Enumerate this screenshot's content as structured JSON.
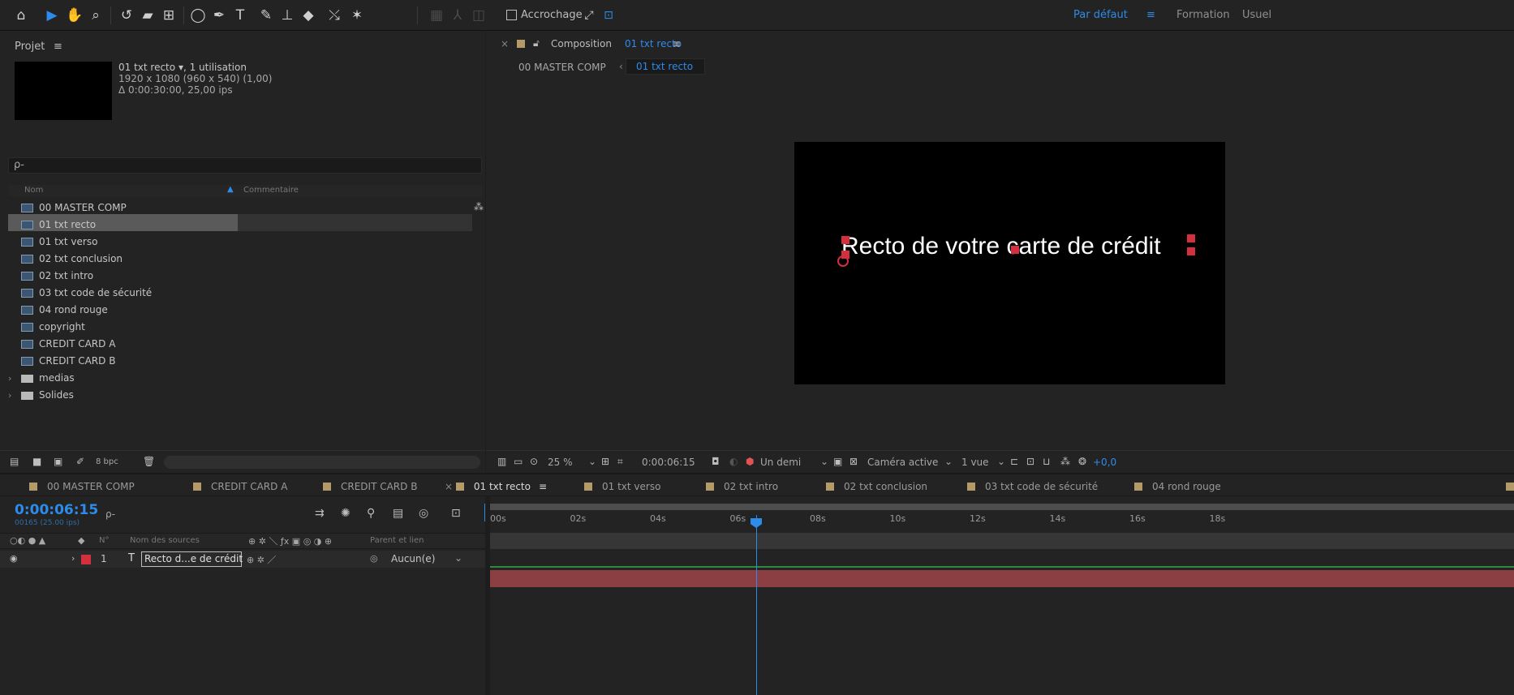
{
  "toolbar": {
    "snapping_label": "Accrochage",
    "workspaces": [
      "Par défaut",
      "Formation",
      "Usuel"
    ],
    "workspace_menu_glyph": "≡"
  },
  "project": {
    "title": "Projet",
    "menu_glyph": "≡",
    "selected_info": {
      "name": "01 txt recto",
      "usage": ", 1 utilisation",
      "resolution": "1920 x 1080  (960 x 540) (1,00)",
      "duration": "Δ 0:00:30:00, 25,00 ips"
    },
    "search_glyph": "ρ-",
    "columns": {
      "name": "Nom",
      "comment": "Commentaire"
    },
    "items": [
      {
        "label": "00 MASTER COMP",
        "type": "comp"
      },
      {
        "label": "01 txt recto",
        "type": "comp"
      },
      {
        "label": "01 txt verso",
        "type": "comp"
      },
      {
        "label": "02 txt conclusion",
        "type": "comp"
      },
      {
        "label": "02 txt intro",
        "type": "comp"
      },
      {
        "label": "03 txt code de sécurité",
        "type": "comp"
      },
      {
        "label": "04 rond rouge",
        "type": "comp"
      },
      {
        "label": "copyright",
        "type": "comp"
      },
      {
        "label": "CREDIT CARD A",
        "type": "comp"
      },
      {
        "label": "CREDIT CARD B",
        "type": "comp"
      },
      {
        "label": "medias",
        "type": "folder"
      },
      {
        "label": "Solides",
        "type": "folder"
      }
    ],
    "bpc": "8 bpc"
  },
  "composition": {
    "label": "Composition",
    "name": "01 txt recto",
    "menu_glyph": "≡",
    "breadcrumb_parent": "00 MASTER COMP",
    "breadcrumb_current": "01 txt recto",
    "canvas_text": "Recto de votre carte de crédit",
    "zoom": "25 %",
    "timecode": "0:00:06:15",
    "resolution": "Un demi",
    "camera": "Caméra active",
    "views": "1 vue",
    "exposure": "+0,0"
  },
  "timeline": {
    "tabs": [
      "00 MASTER COMP",
      "CREDIT CARD A",
      "CREDIT CARD B",
      "01 txt recto",
      "01 txt verso",
      "02 txt intro",
      "02 txt conclusion",
      "03 txt code de sécurité",
      "04 rond rouge"
    ],
    "active_tab_menu": "≡",
    "current_time": "0:00:06:15",
    "current_frame": "00165 (25.00 ips)",
    "ruler": [
      "00s",
      "02s",
      "04s",
      "06s",
      "08s",
      "10s",
      "12s",
      "14s",
      "16s",
      "18s"
    ],
    "columns": {
      "num": "N°",
      "source_name": "Nom des sources",
      "parent": "Parent et lien"
    },
    "layer": {
      "index": "1",
      "type_glyph": "T",
      "name": "Recto d...e de crédit",
      "parent": "Aucun(e)"
    }
  },
  "colors": {
    "accent": "#2d8ceb",
    "layer_bar": "#8b3f43",
    "label_swatch": "#b39a66",
    "panel_bg": "#232323"
  }
}
